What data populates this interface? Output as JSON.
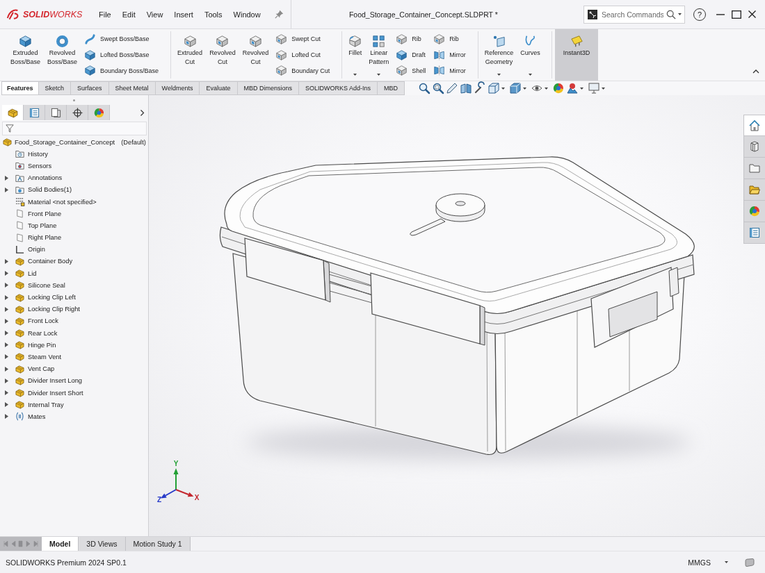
{
  "window": {
    "title": "Food_Storage_Container_Concept.SLDPRT *"
  },
  "logo": {
    "text": "**SOLID**WORKS"
  },
  "menu": [
    "File",
    "Edit",
    "View",
    "Insert",
    "Tools",
    "Window"
  ],
  "search": {
    "placeholder": "Search Commands"
  },
  "help": "?",
  "ribbon": {
    "groups": [
      {
        "items": [
          {
            "kind": "large",
            "label": "Extruded Boss/Base",
            "dropdown": false,
            "on": false
          },
          {
            "kind": "large",
            "label": "Revolved Boss/Base",
            "dropdown": false,
            "on": false
          },
          {
            "kind": "stack",
            "labels": [
              "Swept Boss/Base",
              "Lofted Boss/Base",
              "Boundary Boss/Base"
            ]
          }
        ]
      },
      {
        "items": [
          {
            "kind": "large",
            "label": "Extruded Cut",
            "dropdown": false,
            "on": false
          },
          {
            "kind": "large",
            "label": "Revolved Cut",
            "dropdown": false,
            "on": false
          },
          {
            "kind": "large",
            "label": "Revolved Cut",
            "dropdown": false,
            "on": false
          },
          {
            "kind": "stack",
            "labels": [
              "Swept Cut",
              "Lofted Cut",
              "Boundary Cut"
            ]
          }
        ]
      },
      {
        "items": [
          {
            "kind": "large",
            "label": "Fillet",
            "dropdown": true,
            "on": false
          },
          {
            "kind": "large",
            "label": "Linear Pattern",
            "dropdown": true,
            "on": false
          },
          {
            "kind": "stack",
            "labels": [
              "Rib",
              "Draft",
              "Shell"
            ]
          },
          {
            "kind": "stack",
            "labels": [
              "Rib",
              "Mirror",
              "Mirror"
            ]
          }
        ]
      },
      {
        "items": [
          {
            "kind": "large",
            "label": "Reference Geometry",
            "dropdown": true,
            "on": false
          },
          {
            "kind": "large",
            "label": "Curves",
            "dropdown": true,
            "on": false
          }
        ]
      },
      {
        "items": [
          {
            "kind": "large",
            "label": "Instant3D",
            "dropdown": false,
            "on": true
          }
        ]
      }
    ]
  },
  "command_tabs": [
    {
      "label": "Features",
      "selected": true
    },
    {
      "label": "Sketch",
      "selected": false
    },
    {
      "label": "Surfaces",
      "selected": false
    },
    {
      "label": "Sheet Metal",
      "selected": false
    },
    {
      "label": "Weldments",
      "selected": false
    },
    {
      "label": "Evaluate",
      "selected": false
    },
    {
      "label": "MBD Dimensions",
      "selected": false
    },
    {
      "label": "SOLIDWORKS Add-Ins",
      "selected": false
    },
    {
      "label": "MBD",
      "selected": false
    }
  ],
  "feature_manager": {
    "tabs": [
      {
        "selected": true
      },
      {
        "selected": false
      },
      {
        "selected": false
      },
      {
        "selected": false
      },
      {
        "selected": false
      }
    ],
    "tree": {
      "label": "Food_Storage_Container_Concept",
      "configuration": "(Default)",
      "children": [
        {
          "label": "History",
          "kind": "history",
          "expandable": false
        },
        {
          "label": "Sensors",
          "kind": "sensors",
          "expandable": false
        },
        {
          "label": "Annotations",
          "kind": "annotations",
          "expandable": true
        },
        {
          "label": "Solid Bodies(1)",
          "kind": "bodies",
          "expandable": true
        },
        {
          "label": "Material <not specified>",
          "kind": "material",
          "expandable": false
        },
        {
          "label": "Front Plane",
          "kind": "plane",
          "expandable": false
        },
        {
          "label": "Top Plane",
          "kind": "plane",
          "expandable": false
        },
        {
          "label": "Right Plane",
          "kind": "plane",
          "expandable": false
        },
        {
          "label": "Origin",
          "kind": "origin",
          "expandable": false
        },
        {
          "label": "Container Body",
          "kind": "feature",
          "expandable": true
        },
        {
          "label": "Lid",
          "kind": "feature",
          "expandable": true
        },
        {
          "label": "Silicone Seal",
          "kind": "feature",
          "expandable": true
        },
        {
          "label": "Locking Clip Left",
          "kind": "feature",
          "expandable": true
        },
        {
          "label": "Locking Clip Right",
          "kind": "feature",
          "expandable": true
        },
        {
          "label": "Front Lock",
          "kind": "feature",
          "expandable": true
        },
        {
          "label": "Rear Lock",
          "kind": "feature",
          "expandable": true
        },
        {
          "label": "Hinge Pin",
          "kind": "feature",
          "expandable": true
        },
        {
          "label": "Steam Vent",
          "kind": "feature",
          "expandable": true
        },
        {
          "label": "Vent Cap",
          "kind": "feature",
          "expandable": true
        },
        {
          "label": "Divider Insert Long",
          "kind": "feature",
          "expandable": true
        },
        {
          "label": "Divider Insert Short",
          "kind": "feature",
          "expandable": true
        },
        {
          "label": "Internal Tray",
          "kind": "feature",
          "expandable": true
        },
        {
          "label": "Mates",
          "kind": "mates",
          "expandable": true
        }
      ]
    }
  },
  "viewport": {
    "triad": [
      {
        "label": "Y",
        "color": "#23a035"
      },
      {
        "label": "X",
        "color": "#c4272f"
      },
      {
        "label": "Z",
        "color": "#2639c8"
      }
    ]
  },
  "task_pane": {
    "tabs": [
      {
        "selected": true
      },
      {
        "selected": false
      },
      {
        "selected": false
      },
      {
        "selected": false
      },
      {
        "selected": false
      },
      {
        "selected": false
      }
    ]
  },
  "bottom_tabs": [
    {
      "label": "Model",
      "selected": true
    },
    {
      "label": "3D Views",
      "selected": false
    },
    {
      "label": "Motion Study 1",
      "selected": false
    }
  ],
  "status_bar": {
    "text": "SOLIDWORKS Premium 2024 SP0.1",
    "units": "MMGS"
  }
}
